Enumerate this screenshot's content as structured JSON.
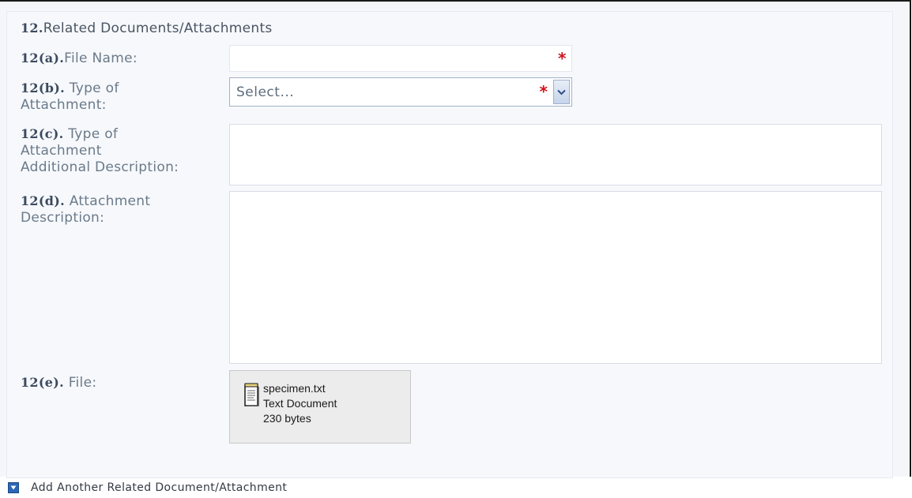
{
  "section": {
    "number": "12.",
    "title": "Related Documents/Attachments"
  },
  "fields": {
    "file_name": {
      "number": "12(a).",
      "label": "File Name:",
      "value": ""
    },
    "type_of_attachment": {
      "number": "12(b).",
      "label_line1": "Type of",
      "label_line2": "Attachment:",
      "selected": "Select..."
    },
    "type_additional": {
      "number": "12(c).",
      "label_line1": "Type of",
      "label_line2": "Attachment",
      "label_line3": "Additional Description:",
      "value": ""
    },
    "attachment_description": {
      "number": "12(d).",
      "label_line1": "Attachment",
      "label_line2": "Description:",
      "value": ""
    },
    "file": {
      "number": "12(e).",
      "label": "File:",
      "name": "specimen.txt",
      "type": "Text Document",
      "size": "230 bytes",
      "icon": "text-document-icon"
    }
  },
  "required_marker": "*",
  "add_another": {
    "label": "Add Another Related Document/Attachment",
    "icon": "expand-arrow-icon"
  },
  "colors": {
    "required": "#d1121c",
    "add_icon": "#2d66b5"
  }
}
